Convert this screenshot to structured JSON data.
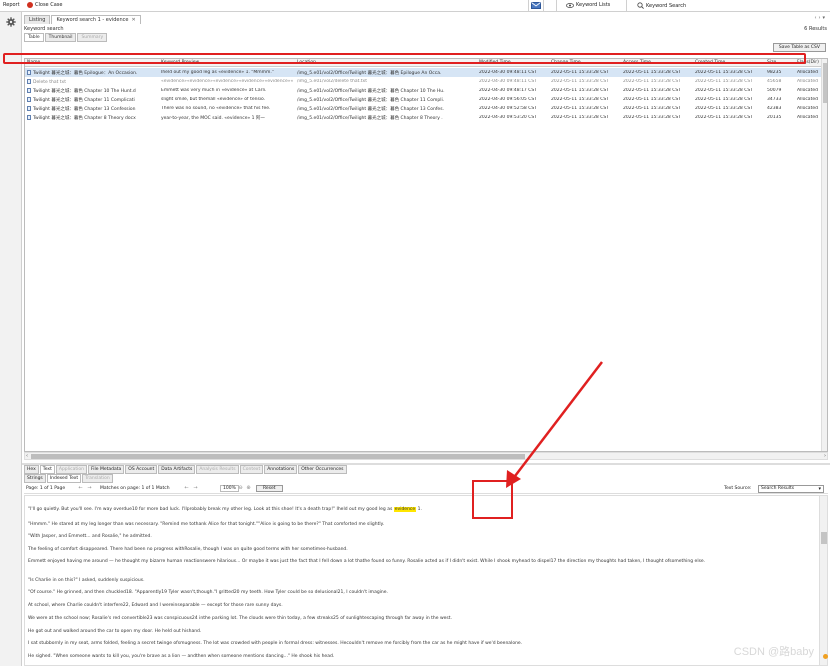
{
  "toolbar": {
    "report": "Report",
    "close_case": "Close Case",
    "keyword_lists": "Keyword Lists",
    "keyword_search": "Keyword Search"
  },
  "doc_tabs": [
    {
      "label": "Listing",
      "active": false
    },
    {
      "label": "Keyword search 1 - evidence",
      "active": true
    }
  ],
  "search": {
    "label": "Keyword search",
    "results": "6 Results"
  },
  "view_tabs": [
    "Table",
    "Thumbnail",
    "Summary"
  ],
  "save_button": "Save Table as CSV",
  "columns": [
    "Name",
    "Keyword Preview",
    "Location",
    "Modified Time",
    "Change Time",
    "Access Time",
    "Created Time",
    "Size",
    "Flags(Dir)"
  ],
  "rows": [
    {
      "name": "Twilight 暮光之城：暮色 Epilogue：An Occasion.",
      "preview": "Iheld out my good leg as «evidence» 1. \"Mmmm.\"",
      "location": "/img_5.e01/vol2/Office/Twilight 暮光之城：暮色 Epilogue An Occa.",
      "mtime": "2022-04-30 09:48:11 CST",
      "ctime": "2022-05-11 15:33:28 CST",
      "atime": "2022-05-11 15:33:28 CST",
      "crtime": "2022-05-11 15:33:28 CST",
      "size": "98235",
      "flags": "Allocated"
    },
    {
      "name": "Delete that txt",
      "preview": "«evidence»«evidence»«evidence»«evidence»«evidence»«",
      "location": "/img_5.e01/vol2/delete that.txt",
      "mtime": "2022-04-30 09:48:11 CST",
      "ctime": "2022-05-11 15:33:28 CST",
      "atime": "2022-05-11 15:33:28 CST",
      "crtime": "2022-05-11 15:33:28 CST",
      "size": "45658",
      "flags": "Allocated"
    },
    {
      "name": "Twilight 暮光之城：暮色 Chapter 10 The Hunt.d",
      "preview": "Emmett was very much in «evidence» at Carli.",
      "location": "/img_5.e01/vol2/Office/Twilight 暮光之城：暮色 Chapter 10 The Hu.",
      "mtime": "2022-04-30 09:48:17 CST",
      "ctime": "2022-05-11 15:33:28 CST",
      "atime": "2022-05-11 15:33:28 CST",
      "crtime": "2022-05-11 15:33:28 CST",
      "size": "50079",
      "flags": "Allocated"
    },
    {
      "name": "Twilight 暮光之城：暮色 Chapter 11 Complicati",
      "preview": "slight smile, but themall «evidence» of tensio.",
      "location": "/img_5.e01/vol2/Office/Twilight 暮光之城：暮色 Chapter 11 Compli.",
      "mtime": "2022-04-30 09:56:05 CST",
      "ctime": "2022-05-11 15:33:28 CST",
      "atime": "2022-05-11 15:33:28 CST",
      "crtime": "2022-05-11 15:33:28 CST",
      "size": "34733",
      "flags": "Allocated"
    },
    {
      "name": "Twilight 暮光之城：暮色 Chapter 13 Confession",
      "preview": "There was no sound, no «evidence» that his fee.",
      "location": "/img_5.e01/vol2/Office/Twilight 暮光之城：暮色 Chapter 13 Confes.",
      "mtime": "2022-04-30 09:52:58 CST",
      "ctime": "2022-05-11 15:33:28 CST",
      "atime": "2022-05-11 15:33:28 CST",
      "crtime": "2022-05-11 15:33:28 CST",
      "size": "42383",
      "flags": "Allocated"
    },
    {
      "name": "Twilight 暮光之城：暮色 Chapter 8 Theory docx",
      "preview": "year-to-year, the MOC said. «evidence» 1 阿一",
      "location": "/img_5.e01/vol2/Office/Twilight 暮光之城：暮色 Chapter 8 Theory .",
      "mtime": "2022-04-30 09:53:20 CST",
      "ctime": "2022-05-11 15:33:28 CST",
      "atime": "2022-05-11 15:33:28 CST",
      "crtime": "2022-05-11 15:33:28 CST",
      "size": "20135",
      "flags": "Allocated"
    }
  ],
  "detail_tabs": [
    {
      "label": "Hex",
      "state": "normal"
    },
    {
      "label": "Text",
      "state": "active"
    },
    {
      "label": "Application",
      "state": "disabled"
    },
    {
      "label": "File Metadata",
      "state": "normal"
    },
    {
      "label": "OS Account",
      "state": "normal"
    },
    {
      "label": "Data Artifacts",
      "state": "normal"
    },
    {
      "label": "Analysis Results",
      "state": "disabled"
    },
    {
      "label": "Context",
      "state": "disabled"
    },
    {
      "label": "Annotations",
      "state": "normal"
    },
    {
      "label": "Other Occurrences",
      "state": "normal"
    }
  ],
  "sub_tabs": [
    {
      "label": "Strings",
      "state": "normal"
    },
    {
      "label": "Indexed Text",
      "state": "active"
    },
    {
      "label": "Translation",
      "state": "disabled"
    }
  ],
  "textbar": {
    "page": "Page: 1 of 1 Page",
    "matches": "Matches on page: 1 of 1 Match",
    "zoom": "100%",
    "reset": "Reset",
    "source_label": "Text Source:",
    "source_value": "Search Results"
  },
  "content": {
    "p1_before": "\"I'll go quietly. But you'll see. I'm way overdue10 for more bad luck. I'llprobably break my other leg. Look at this shoe! It's a death trap!\" Iheld out my good leg as ",
    "p1_mark": "evidence",
    "p1_after": " 1.",
    "p2": "\"Hmmm.\" He stared at my leg longer than was necessary. \"Remind me tothank Alice for that tonight.\"\"Alice is going to be there?\" That comforted me slightly.",
    "p3": "\"With Jasper, and Emmett... and Rosalie,\" he admitted.",
    "p4": "The feeling of comfort disappeared. There had been no progress withRosalie, though I was on quite good terms with her sometimes-husband.",
    "p5": "Emmett enjoyed having me around — he thought my bizarre human reactionswere hilarious... Or maybe it was just the fact that I fell down a lot thathe found so funny. Rosalie acted as if I didn't exist. While I shook myhead to dispel17 the direction my thoughts had taken, I thought ofsomething else.",
    "p6": "\"Is Charlie in on this?\" I asked, suddenly suspicious.",
    "p7": "\"Of course.\" He grinned, and then chuckled18. \"Apparently19 Tyler wasn't,though.\"I gritted20 my teeth. How Tyler could be so delusional21, I couldn't imagine.",
    "p8": "At school, where Charlie couldn't interfere22, Edward and I wereinseparable — except for those rare sunny days.",
    "p9": "We were at the school now; Rosalie's red convertible23 was conspicuous24 inthe parking lot. The clouds were thin today, a few streaks25 of sunlightescaping through far away in the west.",
    "p10": "He got out and walked around the car to open my door. He held out hishand.",
    "p11": "I sat stubbornly in my seat, arms folded, feeling a secret twinge ofsmugness. The lot was crowded with people in formal dress: witnesses. Hecouldn't remove me forcibly from the car as he might have if we'd beenalone.",
    "p12": "He sighed. \"When someone wants to kill you, you're brave as a lion — andthen when someone mentions dancing...\" He shook his head."
  },
  "watermark": "CSDN @路baby",
  "colors": {
    "highlight": "#ffe600",
    "annotation": "#e02020",
    "selected_row": "#d6e5f5"
  }
}
